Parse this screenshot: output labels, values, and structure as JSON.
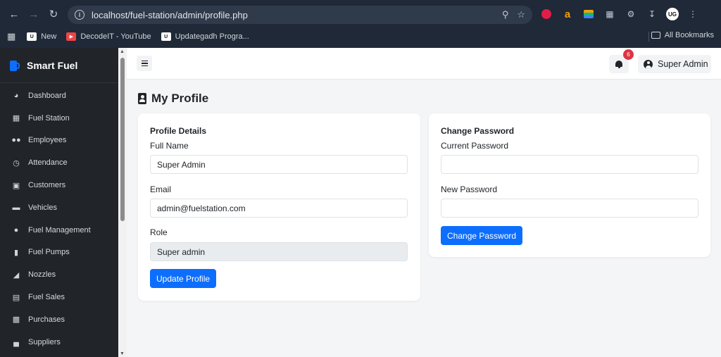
{
  "browser": {
    "url": "localhost/fuel-station/admin/profile.php",
    "bookmarks": [
      {
        "label": "New",
        "icon": "uc-icon"
      },
      {
        "label": "DecodeIT - YouTube",
        "icon": "youtube-icon"
      },
      {
        "label": "Updategadh Progra...",
        "icon": "uc-icon"
      }
    ],
    "all_bookmarks": "All Bookmarks",
    "profile_initials": "UG"
  },
  "sidebar": {
    "brand": "Smart Fuel",
    "items": [
      {
        "label": "Dashboard",
        "icon": "dashboard-icon"
      },
      {
        "label": "Fuel Station",
        "icon": "building-icon"
      },
      {
        "label": "Employees",
        "icon": "users-icon"
      },
      {
        "label": "Attendance",
        "icon": "clock-icon"
      },
      {
        "label": "Customers",
        "icon": "id-card-icon"
      },
      {
        "label": "Vehicles",
        "icon": "truck-icon"
      },
      {
        "label": "Fuel Management",
        "icon": "droplet-icon"
      },
      {
        "label": "Fuel Pumps",
        "icon": "gas-pump-icon"
      },
      {
        "label": "Nozzles",
        "icon": "faucet-icon"
      },
      {
        "label": "Fuel Sales",
        "icon": "receipt-icon"
      },
      {
        "label": "Purchases",
        "icon": "truck-loading-icon"
      },
      {
        "label": "Suppliers",
        "icon": "industry-icon"
      }
    ]
  },
  "topbar": {
    "notifications_count": "6",
    "user_name": "Super Admin"
  },
  "page": {
    "title": "My Profile"
  },
  "profile_details": {
    "title": "Profile Details",
    "full_name_label": "Full Name",
    "full_name_value": "Super Admin",
    "email_label": "Email",
    "email_value": "admin@fuelstation.com",
    "role_label": "Role",
    "role_value": "Super admin",
    "submit_label": "Update Profile"
  },
  "change_password": {
    "title": "Change Password",
    "current_label": "Current Password",
    "current_value": "",
    "new_label": "New Password",
    "new_value": "",
    "submit_label": "Change Password"
  },
  "colors": {
    "sidebar_bg": "#212529",
    "primary": "#0d6efd",
    "badge": "#dc3545",
    "page_bg": "#f4f5f7"
  }
}
